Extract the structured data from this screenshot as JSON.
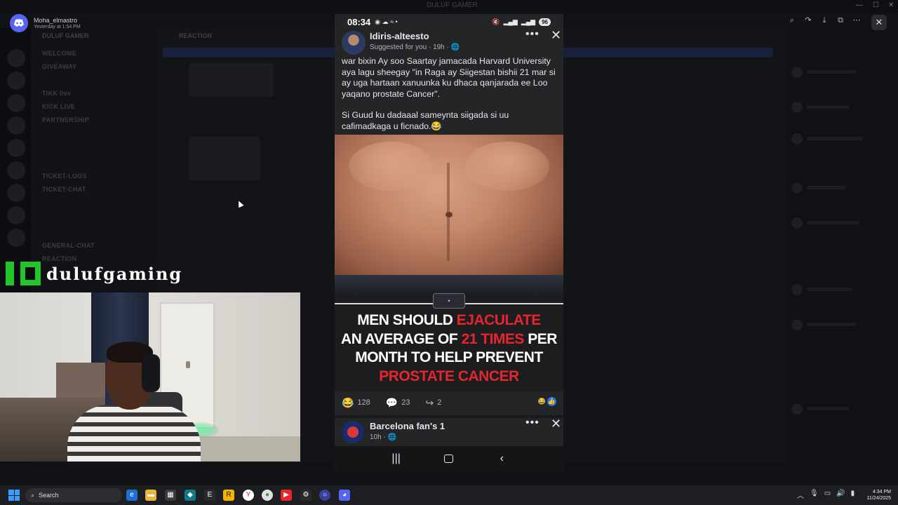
{
  "viewer": {
    "username": "Moha_elmastro",
    "timestamp": "Yesterday at 1:54 PM",
    "tools": [
      "zoom-icon",
      "rotate-icon",
      "download-icon",
      "open-external-icon",
      "more-icon"
    ],
    "close_label": "✕"
  },
  "background": {
    "app_title": "DULUF GAMER",
    "server_name": "DULUF GAMER",
    "channel_header": "REACTION",
    "channels": [
      "WELCOME",
      "GIVEAWAY",
      "TIKK live",
      "KICK LIVE",
      "PARTNERSHIP",
      "TICKET-LOGS",
      "TICKET-CHAT",
      "GENERAL-CHAT",
      "REACTION"
    ]
  },
  "streamer": {
    "brand_name": "dulufgaming",
    "brand_color": "#22c52a"
  },
  "phone": {
    "status_bar": {
      "time": "08:34",
      "battery": "96"
    },
    "post": {
      "author": "Idiris-alteesto",
      "meta_suggested": "Suggested for you",
      "meta_time": "19h",
      "text_p1": "war bixin Ay soo Saartay jamacada Harvard University aya lagu sheegay \"in Raga ay Siigestan bishii 21 mar si ay uga hartaan xanuunka ku dhaca qanjarada ee Loo yaqano prostate Cancer\".",
      "text_p2": "Si Guud ku dadaaal sameynta siigada si uu cafimadkaga u ficnado.😂",
      "headline": {
        "line1_a": "MEN SHOULD ",
        "line1_b": "EJACULATE",
        "line2_a": "AN AVERAGE OF ",
        "line2_b": "21 TIMES",
        "line2_c": " PER",
        "line3": "MONTH TO HELP PREVENT",
        "line4": "PROSTATE CANCER"
      },
      "reactions": "128",
      "comments": "23",
      "shares": "2"
    },
    "next_post": {
      "author": "Barcelona fan's 1",
      "meta_time": "10h"
    }
  },
  "taskbar": {
    "search_placeholder": "Search",
    "time": "4:34 PM",
    "date": "11/24/2025"
  },
  "colors": {
    "accent_red": "#e6262f",
    "facebook_blue": "#1877f2",
    "discord_blurple": "#5865f2"
  }
}
